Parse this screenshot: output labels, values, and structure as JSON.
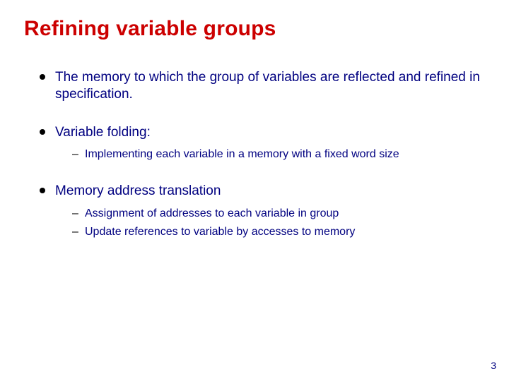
{
  "title": "Refining variable groups",
  "bullets": [
    {
      "text": "The memory to which the group of variables are reflected and refined in specification.",
      "sub": []
    },
    {
      "text": "Variable folding:",
      "sub": [
        {
          "text": "Implementing each variable in a memory with a fixed word size"
        }
      ]
    },
    {
      "text": "Memory address translation",
      "sub": [
        {
          "text": "Assignment of addresses to each variable in group"
        },
        {
          "text": "Update references to variable by accesses to memory"
        }
      ]
    }
  ],
  "page_number": "3"
}
